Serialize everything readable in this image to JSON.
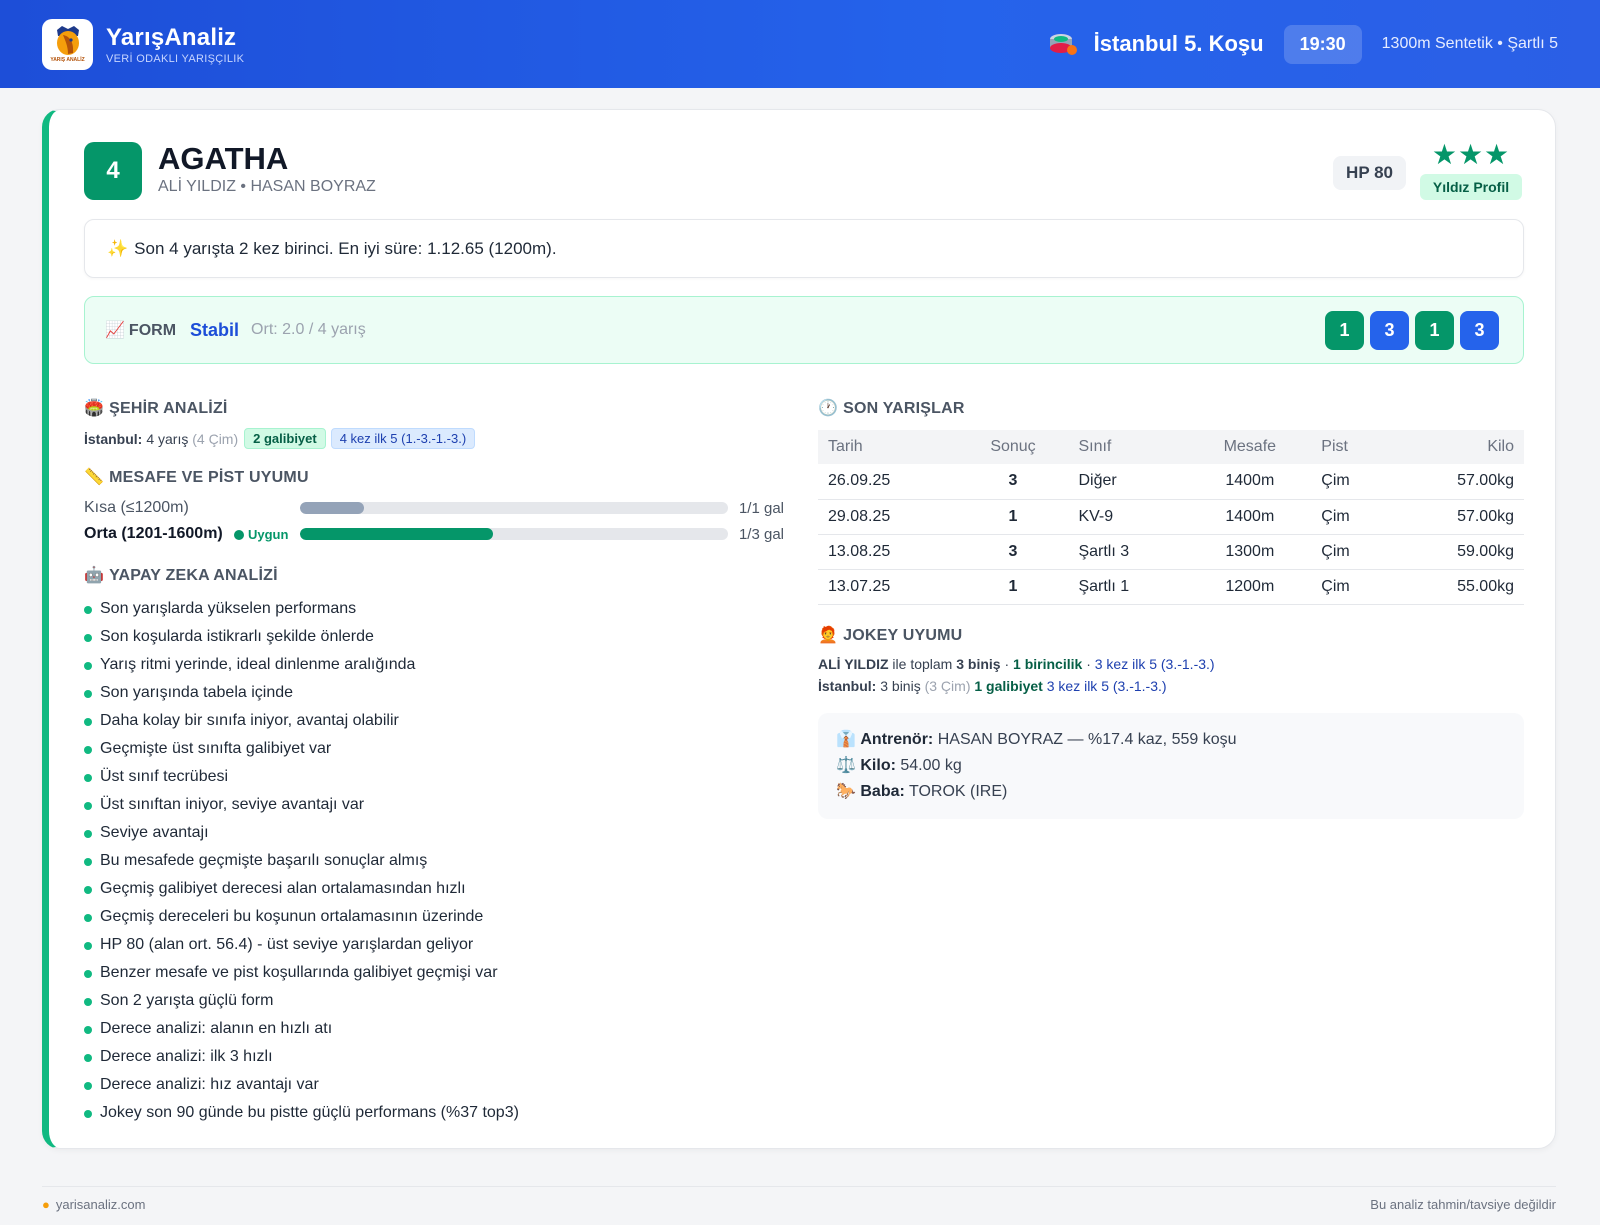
{
  "header": {
    "brand": "YarışAnaliz",
    "tagline": "VERİ ODAKLI YARIŞÇILIK",
    "logo_text": "YARIŞ ANALİZ",
    "race_title": "İstanbul 5. Koşu",
    "time": "19:30",
    "race_info": "1300m Sentetik • Şartlı 5"
  },
  "horse": {
    "number": "4",
    "name": "AGATHA",
    "people": "ALİ YILDIZ • HASAN BOYRAZ",
    "hp": "HP 80",
    "stars": "★★★",
    "star_label": "Yıldız Profil"
  },
  "summary": {
    "icon": "✨",
    "text": "Son 4 yarışta 2 kez birinci. En iyi süre: 1.12.65 (1200m)."
  },
  "form": {
    "label": "FORM",
    "state": "Stabil",
    "avg": "Ort: 2.0 / 4 yarış",
    "results": [
      "1",
      "3",
      "1",
      "3"
    ]
  },
  "city": {
    "title": "ŞEHİR ANALİZİ",
    "name": "İstanbul:",
    "races": "4 yarış",
    "surface": "(4 Çim)",
    "wins": "2 galibiyet",
    "top5": "4 kez ilk 5 (1.-3.-1.-3.)"
  },
  "distance": {
    "title": "MESAFE VE PİST UYUMU",
    "rows": [
      {
        "label": "Kısa (≤1200m)",
        "value": "1/1 gal",
        "fill": 0.15,
        "color": "#94a3b8"
      },
      {
        "label": "Orta (1201-1600m)",
        "badge": "Uygun",
        "value": "1/3 gal",
        "fill": 0.45,
        "color": "#059669"
      }
    ]
  },
  "ai": {
    "title": "YAPAY ZEKA ANALİZİ",
    "items": [
      "Son yarışlarda yükselen performans",
      "Son koşularda istikrarlı şekilde önlerde",
      "Yarış ritmi yerinde, ideal dinlenme aralığında",
      "Son yarışında tabela içinde",
      "Daha kolay bir sınıfa iniyor, avantaj olabilir",
      "Geçmişte üst sınıfta galibiyet var",
      "Üst sınıf tecrübesi",
      "Üst sınıftan iniyor, seviye avantajı var",
      "Seviye avantajı",
      "Bu mesafede geçmişte başarılı sonuçlar almış",
      "Geçmiş galibiyet derecesi alan ortalamasından hızlı",
      "Geçmiş dereceleri bu koşunun ortalamasının üzerinde",
      "HP 80 (alan ort. 56.4) - üst seviye yarışlardan geliyor",
      "Benzer mesafe ve pist koşullarında galibiyet geçmişi var",
      "Son 2 yarışta güçlü form",
      "Derece analizi: alanın en hızlı atı",
      "Derece analizi: ilk 3 hızlı",
      "Derece analizi: hız avantajı var",
      "Jokey son 90 günde bu pistte güçlü performans (%37 top3)"
    ]
  },
  "recent": {
    "title": "SON YARIŞLAR",
    "columns": [
      "Tarih",
      "Sonuç",
      "Sınıf",
      "Mesafe",
      "Pist",
      "Kilo"
    ],
    "rows": [
      [
        "26.09.25",
        "3",
        "Diğer",
        "1400m",
        "Çim",
        "57.00kg"
      ],
      [
        "29.08.25",
        "1",
        "KV-9",
        "1400m",
        "Çim",
        "57.00kg"
      ],
      [
        "13.08.25",
        "3",
        "Şartlı 3",
        "1300m",
        "Çim",
        "59.00kg"
      ],
      [
        "13.07.25",
        "1",
        "Şartlı 1",
        "1200m",
        "Çim",
        "55.00kg"
      ]
    ]
  },
  "jockey": {
    "title": "JOKEY UYUMU",
    "name": "ALİ YILDIZ",
    "with_total": "ile toplam",
    "rides": "3 biniş",
    "sep": "·",
    "wins": "1 birincilik",
    "top5": "3 kez ilk 5 (3.-1.-3.)",
    "city_label": "İstanbul:",
    "city_rides": "3 biniş",
    "city_surface": "(3 Çim)",
    "city_wins": "1 galibiyet",
    "city_top5": "3 kez ilk 5 (3.-1.-3.)"
  },
  "info": {
    "trainer_icon": "👔",
    "trainer_label": "Antrenör:",
    "trainer_value": "HASAN BOYRAZ — %17.4 kaz, 559 koşu",
    "weight_icon": "⚖️",
    "weight_label": "Kilo:",
    "weight_value": "54.00 kg",
    "sire_icon": "🐎",
    "sire_label": "Baba:",
    "sire_value": "TOROK (IRE)"
  },
  "footer": {
    "site": "yarisanaliz.com",
    "disclaimer": "Bu analiz tahmin/tavsiye değildir"
  },
  "colors": {
    "header": "#2563eb",
    "accent_green": "#059669",
    "accent_blue": "#2563eb",
    "accent_orange": "#d97706"
  }
}
